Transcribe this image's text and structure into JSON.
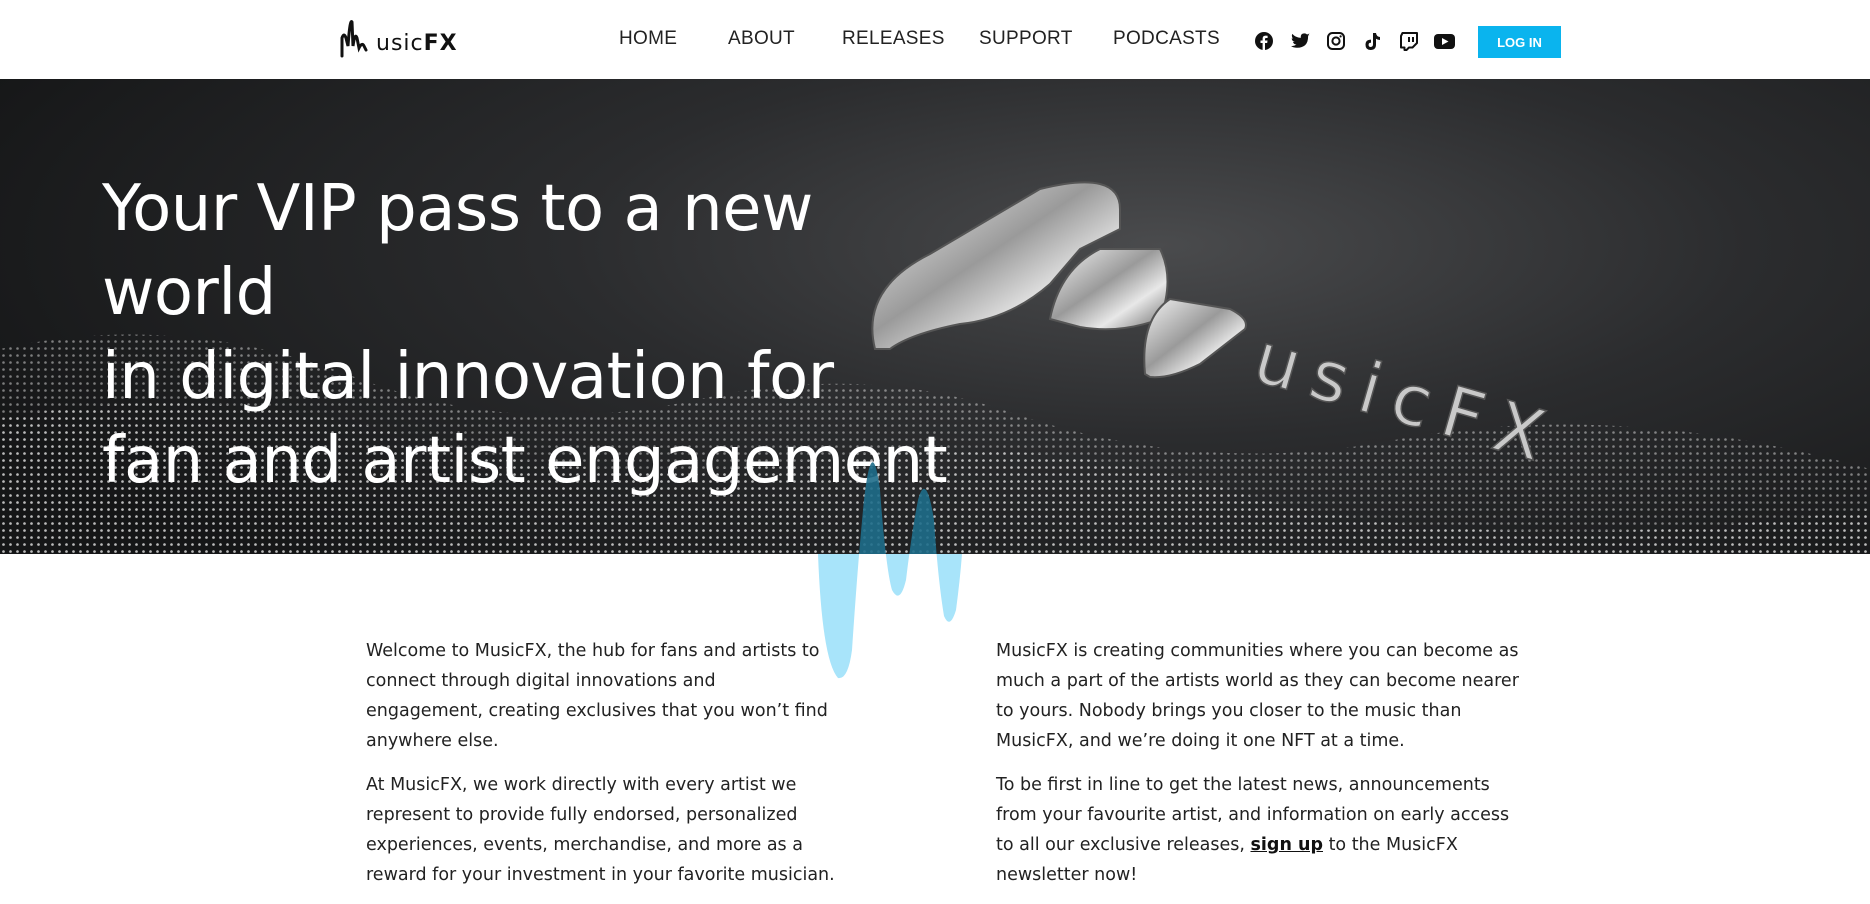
{
  "header": {
    "logo": {
      "text_light": "usic",
      "text_bold": "FX",
      "alt": "MusicFX"
    },
    "nav": [
      {
        "label": "HOME"
      },
      {
        "label": "ABOUT"
      },
      {
        "label": "RELEASES"
      },
      {
        "label": "SUPPORT"
      },
      {
        "label": "PODCASTS"
      }
    ],
    "social_icons": [
      "facebook-icon",
      "twitter-icon",
      "instagram-icon",
      "tiktok-icon",
      "twitch-icon",
      "youtube-icon"
    ],
    "login_label": "LOG IN"
  },
  "hero": {
    "title_lines": [
      "Your VIP pass to a new world",
      "in digital innovation for",
      "fan and artist engagement"
    ],
    "logo_3d": {
      "text": "usicFX"
    }
  },
  "content": {
    "left": [
      "Welcome to MusicFX, the hub for fans and artists to connect through digital innovations and engagement, creating exclusives that you won’t find anywhere else.",
      "At MusicFX, we work directly with every artist we represent to provide fully endorsed, personalized experiences, events, merchandise, and more as a reward for your investment in your favorite musician."
    ],
    "right": [
      "MusicFX is creating communities where you can become as much a part of the artists world as they can become nearer to yours. Nobody brings you closer to the music than MusicFX, and we’re doing it one NFT at a time."
    ],
    "signup": {
      "before": "To be first in line to get the latest news, announcements from your favourite artist, and information on early access to all our exclusive releases, ",
      "link": "sign up",
      "after": " to the MusicFX newsletter now!"
    }
  },
  "colors": {
    "accent": "#0ab4ee",
    "wave_light": "#a8e4fa",
    "wave_dark": "#1e6d8a",
    "hero_bg": "#1f2022"
  }
}
